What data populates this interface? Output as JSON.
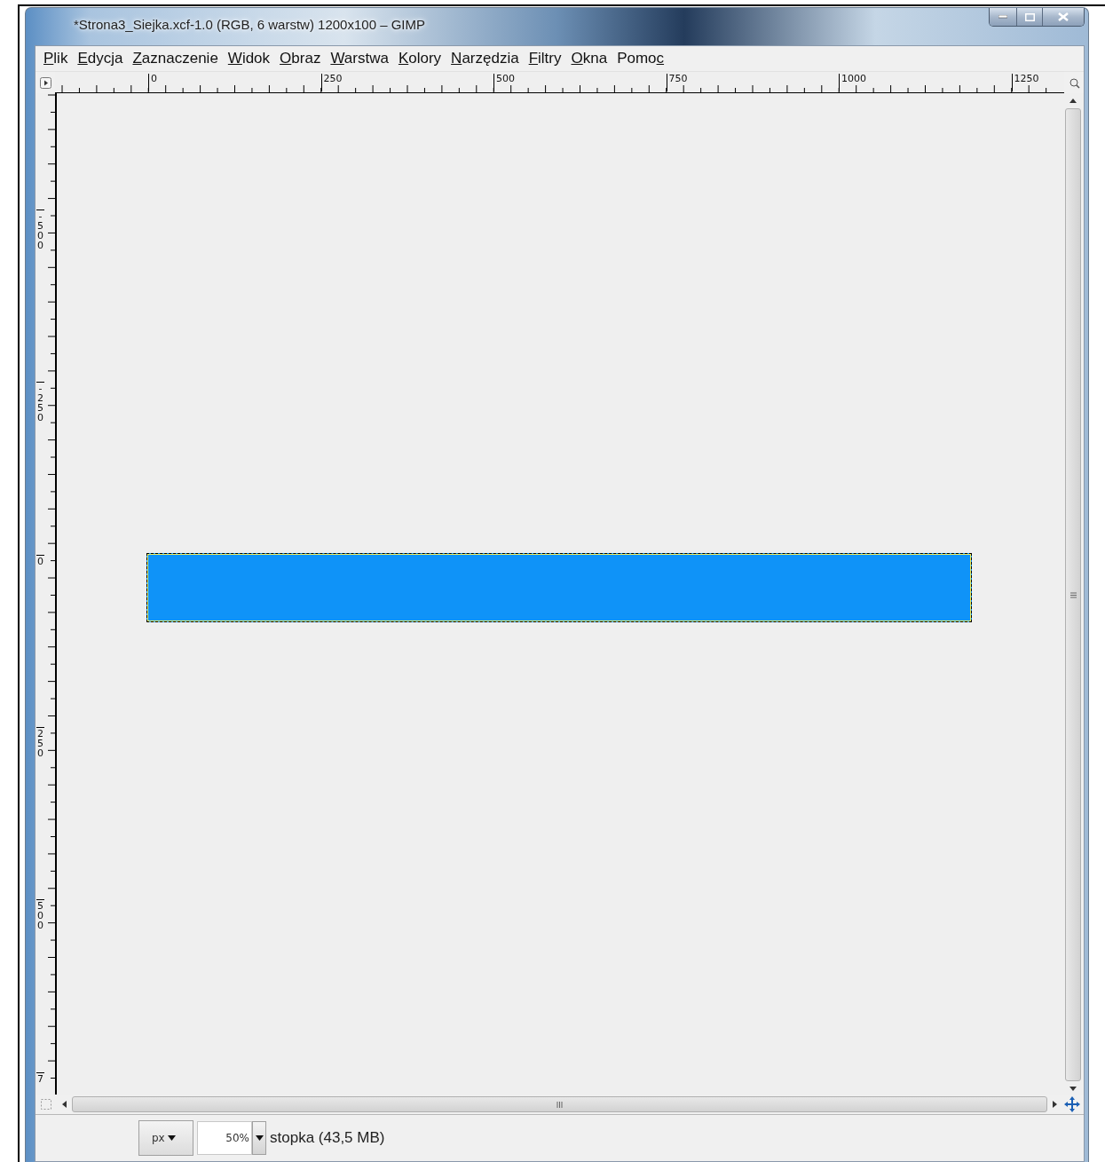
{
  "window": {
    "title": "*Strona3_Siejka.xcf-1.0 (RGB, 6 warstw) 1200x100 – GIMP"
  },
  "menu": [
    {
      "key": "P",
      "after": "lik"
    },
    {
      "key": "E",
      "after": "dycja"
    },
    {
      "key": "Z",
      "after": "aznaczenie"
    },
    {
      "key": "W",
      "after": "idok"
    },
    {
      "key": "O",
      "after": "braz"
    },
    {
      "key": "W",
      "after": "arstwa"
    },
    {
      "key": "K",
      "after": "olory"
    },
    {
      "key": "N",
      "after": "arzędzia"
    },
    {
      "key": "F",
      "after": "iltry"
    },
    {
      "key": "O",
      "after": "kna"
    },
    {
      "before": "Pomo",
      "key": "c"
    }
  ],
  "rulers": {
    "horizontal": [
      "0",
      "250",
      "500",
      "750",
      "1000",
      "1250"
    ],
    "vertical": [
      "-500",
      "-250",
      "0",
      "250",
      "500",
      "7"
    ]
  },
  "image": {
    "selected": true
  },
  "status_bar": {
    "unit": "px",
    "zoom": "50%",
    "info": "stopka (43,5 MB)"
  }
}
